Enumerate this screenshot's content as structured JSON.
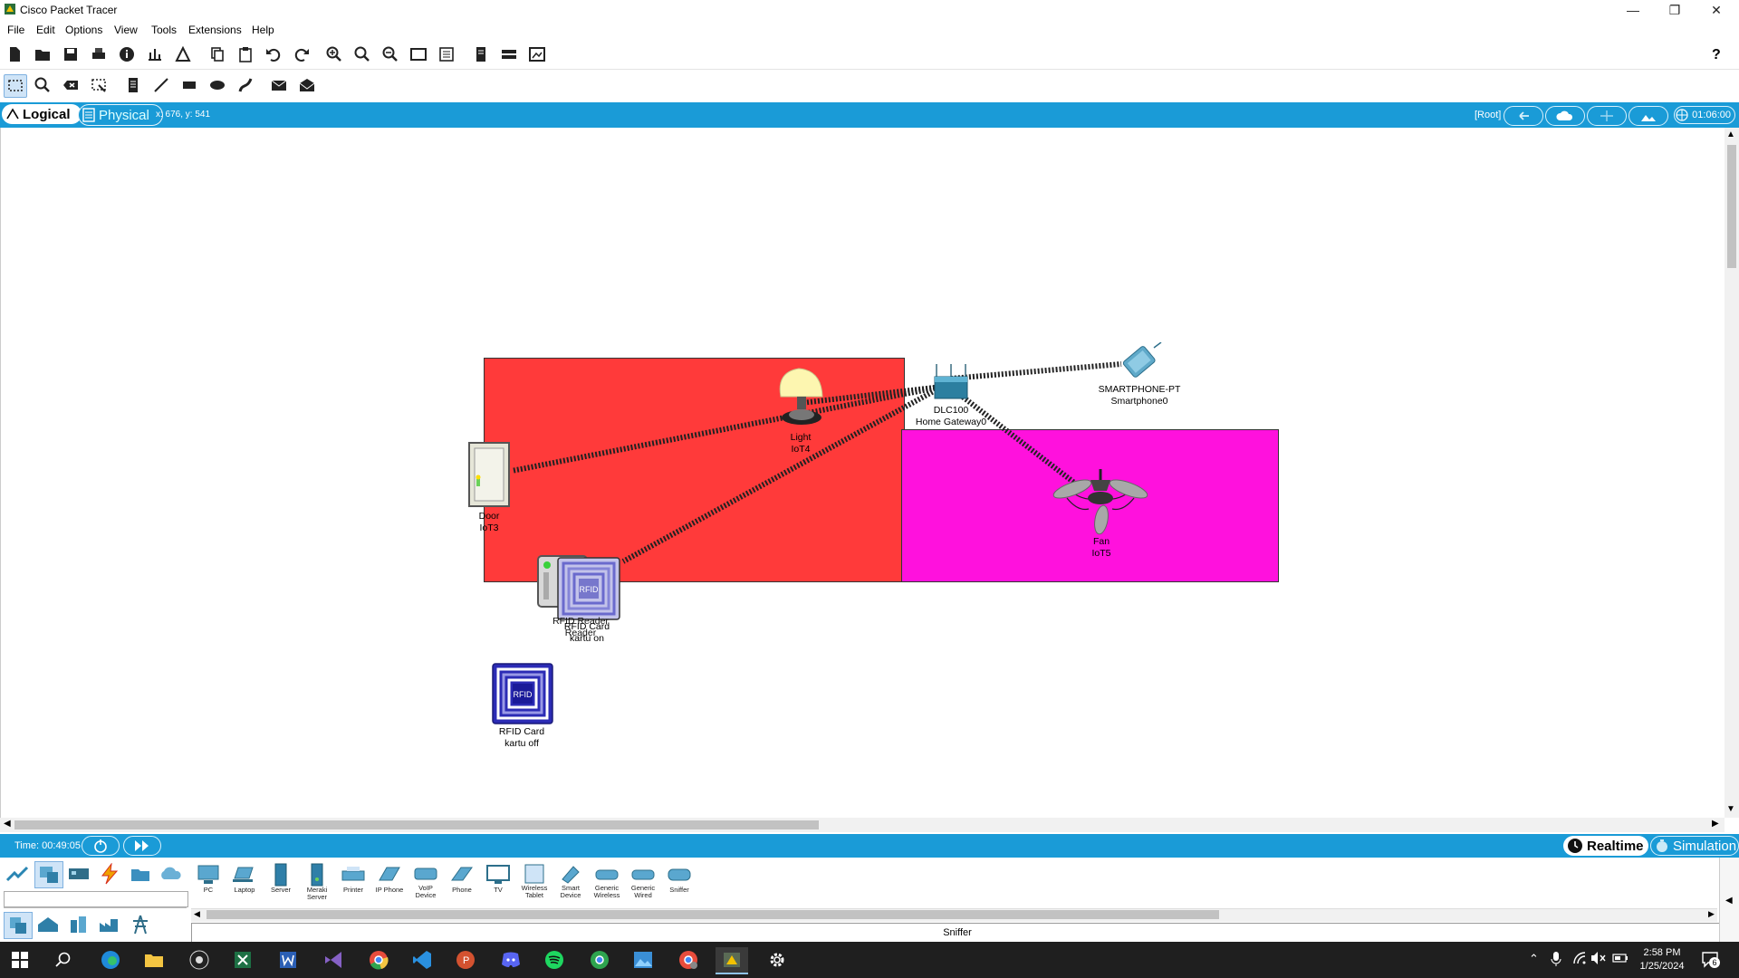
{
  "window": {
    "title": "Cisco Packet Tracer",
    "controls": [
      "minimize",
      "restore",
      "close"
    ]
  },
  "menu": [
    "File",
    "Edit",
    "Options",
    "View",
    "Tools",
    "Extensions",
    "Help"
  ],
  "toolbar_main": [
    "new-icon",
    "open-icon",
    "save-icon",
    "print-icon",
    "info-icon",
    "network-wizard-icon",
    "activity-wizard-icon",
    "copy-icon",
    "paste-icon",
    "undo-icon",
    "redo-icon",
    "zoom-in-icon",
    "zoom-reset-icon",
    "zoom-out-icon",
    "drawing-palette-icon",
    "custom-device-icon",
    "pdu-list-icon",
    "cluster-icon",
    "viewport-icon"
  ],
  "toolbar_edit": [
    "select-icon",
    "inspect-icon",
    "delete-icon",
    "resize-icon",
    "note-icon",
    "line-icon",
    "rectangle-icon",
    "ellipse-icon",
    "freeform-icon",
    "simple-pdu-icon",
    "complex-pdu-icon"
  ],
  "workspace_bar": {
    "logical_label": "Logical",
    "physical_label": "Physical",
    "coords": "x: 676, y: 541",
    "root_label": "[Root]",
    "clock": "01:06:00"
  },
  "areas": [
    {
      "name": "red-zone",
      "color": "#ff3a3a"
    },
    {
      "name": "magenta-zone",
      "color": "#ff11dd"
    }
  ],
  "devices": {
    "light": {
      "model": "Light",
      "name": "IoT4"
    },
    "door": {
      "model": "Door",
      "name": "IoT3"
    },
    "gateway": {
      "model": "DLC100",
      "name": "Home Gateway0"
    },
    "smartphone": {
      "model": "SMARTPHONE-PT",
      "name": "Smartphone0"
    },
    "fan": {
      "model": "Fan",
      "name": "IoT5"
    },
    "rfid_reader": {
      "model": "RFID Reader",
      "name": "Reader"
    },
    "rfid_card_on": {
      "model": "RFID Card",
      "name": "kartu on"
    },
    "rfid_card_off": {
      "model": "RFID Card",
      "name": "kartu off"
    },
    "rfid_text": "RFID"
  },
  "simulation_bar": {
    "time": "Time: 00:49:05",
    "realtime_label": "Realtime",
    "simulation_label": "Simulation"
  },
  "palette": {
    "categories": [
      "network-devices-icon",
      "end-devices-icon",
      "components-icon",
      "connections-icon",
      "miscellaneous-icon",
      "multiuser-icon"
    ],
    "subcategories": [
      "end-devices-sub-icon",
      "home-icon",
      "smart-city-icon",
      "industrial-icon",
      "power-grid-icon"
    ],
    "devices": [
      [
        "PC"
      ],
      [
        "Laptop"
      ],
      [
        "Server"
      ],
      [
        "Meraki Server"
      ],
      [
        "Printer"
      ],
      [
        "IP Phone"
      ],
      [
        "VoIP",
        "Device"
      ],
      [
        "Phone"
      ],
      [
        "TV"
      ],
      [
        "Wireless",
        "Tablet"
      ],
      [
        "Smart",
        "Device"
      ],
      [
        "Generic",
        "Wireless"
      ],
      [
        "Generic",
        "Wired"
      ],
      [
        "Sniffer"
      ]
    ],
    "selected_label": "Sniffer"
  },
  "taskbar": {
    "apps": [
      "start-icon",
      "search-icon",
      "edge-icon",
      "file-explorer-icon",
      "obs-icon",
      "excel-icon",
      "word-icon",
      "visual-studio-icon",
      "chrome-icon",
      "vscode-icon",
      "powerpoint-icon",
      "discord-icon",
      "spotify-icon",
      "chrome-profile-icon",
      "photos-icon",
      "chrome-alt-icon",
      "packet-tracer-icon",
      "settings-icon"
    ],
    "time": "2:58 PM",
    "date": "1/25/2024",
    "notification_count": "6"
  }
}
